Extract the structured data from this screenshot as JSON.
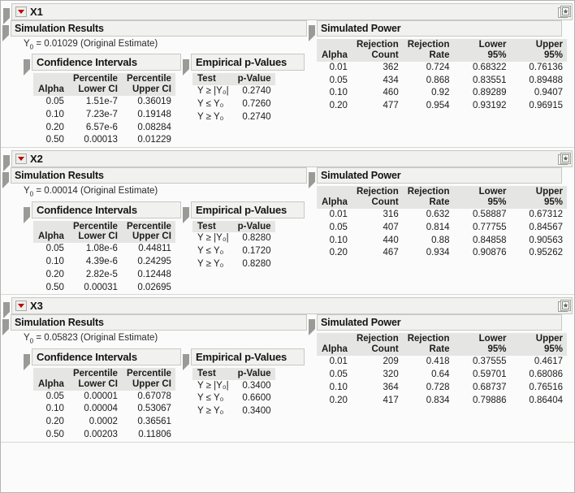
{
  "window": {
    "icons": {
      "outline_disclosure": "triangle-open-icon",
      "red_menu": "red-triangle-menu-icon",
      "star_button": "make-into-data-table-star-icon"
    },
    "colors": {
      "accent_red": "#c00000",
      "header_bg": "#f1f1ef",
      "table_header_bg": "#e5e5e3",
      "border": "#c8c8c4",
      "text": "#1a1a1a"
    }
  },
  "labels": {
    "simulation_results": "Simulation Results",
    "simulated_power": "Simulated Power",
    "confidence_intervals": "Confidence Intervals",
    "empirical_p_values": "Empirical p-Values",
    "original_estimate_suffix": "(Original Estimate)",
    "y0_prefix": "Y",
    "y0_sub": "0",
    "equals": "="
  },
  "ci_headers": [
    "Alpha",
    "Percentile\nLower CI",
    "Percentile\nUpper CI"
  ],
  "pv_headers": [
    "Test",
    "p-Value"
  ],
  "power_headers": [
    "Alpha",
    "Rejection\nCount",
    "Rejection\nRate",
    "Lower 95%",
    "Upper 95%"
  ],
  "tests": [
    "Y ≥ |Y₀|",
    "Y ≤ Y₀",
    "Y ≥ Y₀"
  ],
  "sections": [
    {
      "title": "X1",
      "y0": "0.01029",
      "confidence_intervals": {
        "alpha": [
          "0.05",
          "0.10",
          "0.20",
          "0.50"
        ],
        "lower_ci": [
          "1.51e-7",
          "7.23e-7",
          "6.57e-6",
          "0.00013"
        ],
        "upper_ci": [
          "0.36019",
          "0.19148",
          "0.08284",
          "0.01229"
        ]
      },
      "p_values": [
        "0.2740",
        "0.7260",
        "0.2740"
      ],
      "power": {
        "alpha": [
          "0.01",
          "0.05",
          "0.10",
          "0.20"
        ],
        "rejection_count": [
          "362",
          "434",
          "460",
          "477"
        ],
        "rejection_rate": [
          "0.724",
          "0.868",
          "0.92",
          "0.954"
        ],
        "lower_95": [
          "0.68322",
          "0.83551",
          "0.89289",
          "0.93192"
        ],
        "upper_95": [
          "0.76136",
          "0.89488",
          "0.9407",
          "0.96915"
        ]
      }
    },
    {
      "title": "X2",
      "y0": "0.00014",
      "confidence_intervals": {
        "alpha": [
          "0.05",
          "0.10",
          "0.20",
          "0.50"
        ],
        "lower_ci": [
          "1.08e-6",
          "4.39e-6",
          "2.82e-5",
          "0.00031"
        ],
        "upper_ci": [
          "0.44811",
          "0.24295",
          "0.12448",
          "0.02695"
        ]
      },
      "p_values": [
        "0.8280",
        "0.1720",
        "0.8280"
      ],
      "power": {
        "alpha": [
          "0.01",
          "0.05",
          "0.10",
          "0.20"
        ],
        "rejection_count": [
          "316",
          "407",
          "440",
          "467"
        ],
        "rejection_rate": [
          "0.632",
          "0.814",
          "0.88",
          "0.934"
        ],
        "lower_95": [
          "0.58887",
          "0.77755",
          "0.84858",
          "0.90876"
        ],
        "upper_95": [
          "0.67312",
          "0.84567",
          "0.90563",
          "0.95262"
        ]
      }
    },
    {
      "title": "X3",
      "y0": "0.05823",
      "confidence_intervals": {
        "alpha": [
          "0.05",
          "0.10",
          "0.20",
          "0.50"
        ],
        "lower_ci": [
          "0.00001",
          "0.00004",
          "0.0002",
          "0.00203"
        ],
        "upper_ci": [
          "0.67078",
          "0.53067",
          "0.36561",
          "0.11806"
        ]
      },
      "p_values": [
        "0.3400",
        "0.6600",
        "0.3400"
      ],
      "power": {
        "alpha": [
          "0.01",
          "0.05",
          "0.10",
          "0.20"
        ],
        "rejection_count": [
          "209",
          "320",
          "364",
          "417"
        ],
        "rejection_rate": [
          "0.418",
          "0.64",
          "0.728",
          "0.834"
        ],
        "lower_95": [
          "0.37555",
          "0.59701",
          "0.68737",
          "0.79886"
        ],
        "upper_95": [
          "0.4617",
          "0.68086",
          "0.76516",
          "0.86404"
        ]
      }
    }
  ]
}
